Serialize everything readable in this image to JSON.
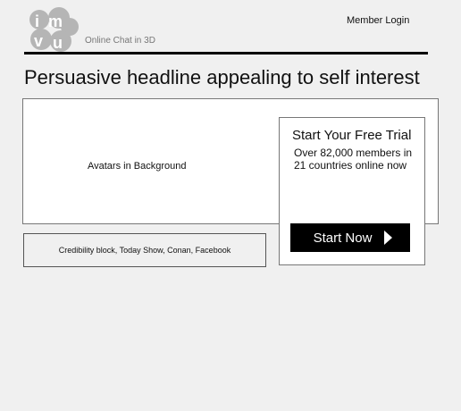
{
  "header": {
    "logo_text": "imvu",
    "tagline": "Online Chat in 3D",
    "member_login": "Member Login"
  },
  "headline": "Persuasive headline appealing to self interest",
  "hero": {
    "avatars_label": "Avatars in Background"
  },
  "trial": {
    "title": "Start Your Free Trial",
    "subtitle": "Over 82,000 members in 21 countries online now",
    "button_label": "Start Now",
    "button_icon": "play-icon"
  },
  "credibility": {
    "text": "Credibility block, Today Show, Conan, Facebook"
  },
  "colors": {
    "background": "#f0f0f0",
    "button_bg": "#000000",
    "button_text": "#ffffff",
    "logo_gray": "#b5b5b5"
  }
}
